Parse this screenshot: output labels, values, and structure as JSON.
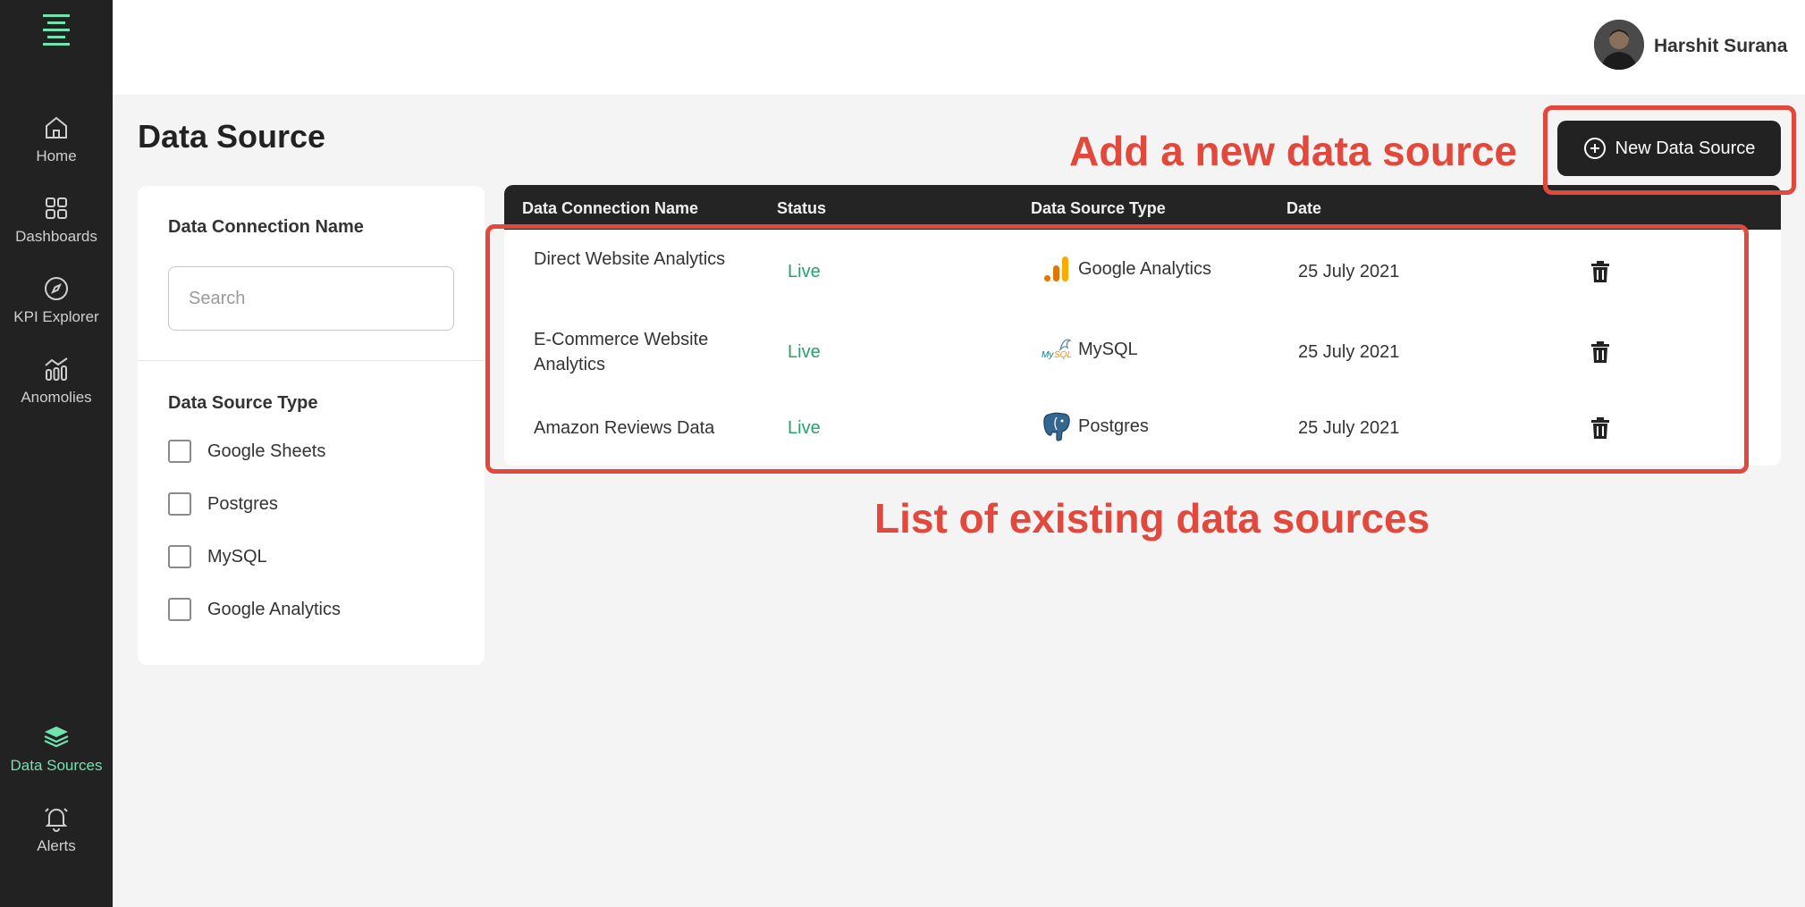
{
  "sidebar": {
    "items": [
      {
        "label": "Home",
        "icon": "home-icon"
      },
      {
        "label": "Dashboards",
        "icon": "grid-icon"
      },
      {
        "label": "KPI Explorer",
        "icon": "compass-icon"
      },
      {
        "label": "Anomolies",
        "icon": "chart-icon"
      },
      {
        "label": "Data Sources",
        "icon": "layers-icon",
        "active": true
      },
      {
        "label": "Alerts",
        "icon": "bell-icon"
      }
    ],
    "active_color": "#6fe3b0"
  },
  "user": {
    "name": "Harshit Surana"
  },
  "page": {
    "title": "Data Source"
  },
  "toolbar": {
    "new_label": "New Data Source"
  },
  "filters": {
    "name_label": "Data Connection Name",
    "search_placeholder": "Search",
    "type_label": "Data Source Type",
    "options": [
      "Google Sheets",
      "Postgres",
      "MySQL",
      "Google Analytics"
    ]
  },
  "table": {
    "headers": [
      "Data Connection Name",
      "Status",
      "Data Source Type",
      "Date"
    ],
    "rows": [
      {
        "name": "Direct Website Analytics",
        "status": "Live",
        "type": "Google Analytics",
        "type_icon": "google-analytics-icon",
        "date": "25 July 2021"
      },
      {
        "name": "E-Commerce Website Analytics",
        "status": "Live",
        "type": "MySQL",
        "type_icon": "mysql-icon",
        "date": "25 July 2021"
      },
      {
        "name": "Amazon Reviews Data",
        "status": "Live",
        "type": "Postgres",
        "type_icon": "postgres-icon",
        "date": "25 July 2021"
      }
    ]
  },
  "annotations": {
    "add_new": "Add a new data source",
    "list": "List of existing data sources",
    "color": "#e2483c"
  }
}
